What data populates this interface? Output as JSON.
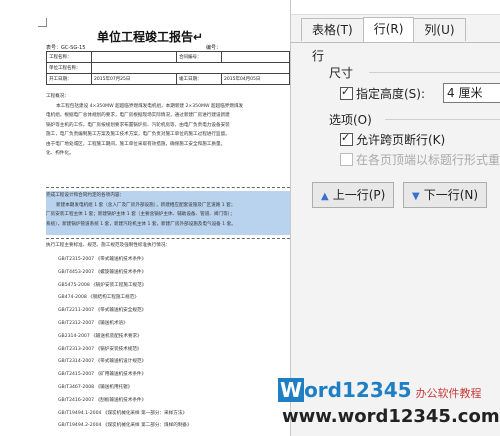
{
  "document": {
    "title": "单位工程竣工报告↵",
    "table_no_label": "表号：GC-SG-15",
    "number_label": "编号：",
    "info_rows": [
      [
        "工程名称：",
        "",
        "合同编号：",
        ""
      ],
      [
        "单位工程名称：",
        "",
        "",
        ""
      ],
      [
        "开工日期：",
        "2015年07月25日",
        "竣工日期：",
        "2015年04月05日"
      ]
    ],
    "overview_heading": "工程概况：",
    "overview_lines": [
      "本工程包括建设 4×350MW 超超临界燃煤发电机组，本期新建 2×350MW 超超临界燃煤发",
      "电机组，根据电厂总体规划的要求，电厂房根据现场实际情况，通过新建厂房进行建设新建",
      "锅炉等主机的工作，电厂房按规划要求布置锅炉房、汽轮机房等，由电厂负责电力设备安装",
      "施工，电厂负责编制施工方案及施工技术方案，电厂负责对施工单位的施工过程进行监督。",
      "由于电厂地处城区，工程施工期间，施工单位采取有效措施，确保施工安全和施工质量。",
      "化、构件化。"
    ],
    "quality_heading": "完成工程设计和合同约定的各项内容：",
    "quality_lines": [
      "新建本期发电机组 1 套（含入厂及厂房外部设施），新建相应配套设施及厂区道路 1 套；",
      "厂房安装工程主体 1 套；新建锅炉主体 1 套（主要含锅炉主体、辅助设备、管道、阀门等）；",
      "系统），新建锅炉管道系统 1 套，新建汽轮机主体 1 套，新建厂房外部设施及电气设备 1 套。"
    ],
    "standards_heading": "执行工程主要标准、规范、施工规范及强制性标准执行情况：",
    "standards": [
      "GB/T2315-2007 《带式输送机技术条件》",
      "GB/T4453-2007 《螺旋输送机技术条件》",
      "GB5475-2008 《锅炉安装工程施工规范》",
      "GB474-2008 《钢结构工程施工规范》",
      "GB/T2211-2007 《带式输送机安全规范》",
      "GB/T2312-2007 《输送机术语》",
      "GB2314-2007 《输送机装配技术要求》",
      "GB/T2313-2007 《锅炉安装技术规范》",
      "GB/T2314-2007 《带式输送机设计规范》",
      "GB/T2415-2007 《矿用输送机技术条件》",
      "GB/T3467-2008 《输送机用托辊》",
      "GB/T2416-2007 《刮板输送机技术条件》",
      "GB/T19494.1-2004 《煤炭机械化采样 第一部分：采样方法》",
      "GB/T19494.2-2004 《煤炭机械化采样 第二部分：煤样的制备》"
    ]
  },
  "dialog": {
    "tabs": [
      "表格(T)",
      "行(R)",
      "列(U)"
    ],
    "active_tab": 1,
    "row_label": "行",
    "size_label": "尺寸",
    "specify_height_label": "指定高度(S):",
    "height_value": "4 厘米",
    "options_label": "选项(O)",
    "allow_break_label": "允许跨页断行(K)",
    "repeat_header_label": "在各页顶端以标题行形式重复",
    "prev_row_label": "上一行(P)",
    "next_row_label": "下一行(N)"
  },
  "watermark": {
    "brand_w": "W",
    "brand_rest": "ord12345",
    "tagline": "办公软件教程",
    "url": "www.word12345.com"
  }
}
